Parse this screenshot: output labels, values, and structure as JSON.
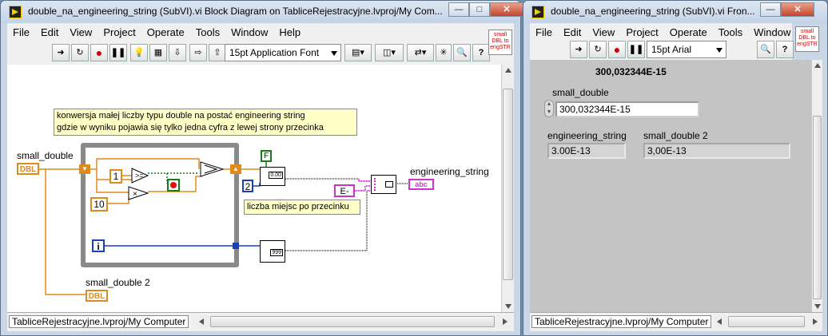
{
  "diagram_window": {
    "title": "double_na_engineering_string (SubVI).vi Block Diagram on TabliceRejestracyjne.lvproj/My Com...",
    "menu": [
      "File",
      "Edit",
      "View",
      "Project",
      "Operate",
      "Tools",
      "Window",
      "Help"
    ],
    "font_selector": "15pt Application Font",
    "vi_icon_text": "small DBL to engSTR",
    "comment_line1": "konwersja małej  liczby typu double na postać engineering string",
    "comment_line2": "gdzie w wyniku pojawia się tylko jedna cyfra z lewej strony przecinka",
    "label_small_double": "small_double",
    "label_small_double_2": "small_double 2",
    "label_engineering_string": "engineering_string",
    "const_one": "1",
    "const_ten": "10",
    "const_two": "2",
    "const_i": "i",
    "const_F": "F",
    "const_E": "E-",
    "label_decimal_places": "liczba miejsc po przecinku",
    "term_dbl": "DBL",
    "term_abc": "abc",
    "status_path": "TabliceRejestracyjne.lvproj/My Computer"
  },
  "panel_window": {
    "title": "double_na_engineering_string (SubVI).vi Fron...",
    "menu": [
      "File",
      "Edit",
      "View",
      "Project",
      "Operate",
      "Tools",
      "Window"
    ],
    "font_selector": "15pt Arial",
    "vi_icon_text": "small DBL to engSTR",
    "header_value": "300,032344E-15",
    "label_small_double": "small_double",
    "value_small_double": "300,032344E-15",
    "label_engineering_string": "engineering_string",
    "value_engineering_string": "3.00E-13",
    "label_small_double_2": "small_double 2",
    "value_small_double_2": "3,00E-13",
    "status_path": "TabliceRejestracyjne.lvproj/My Computer"
  }
}
